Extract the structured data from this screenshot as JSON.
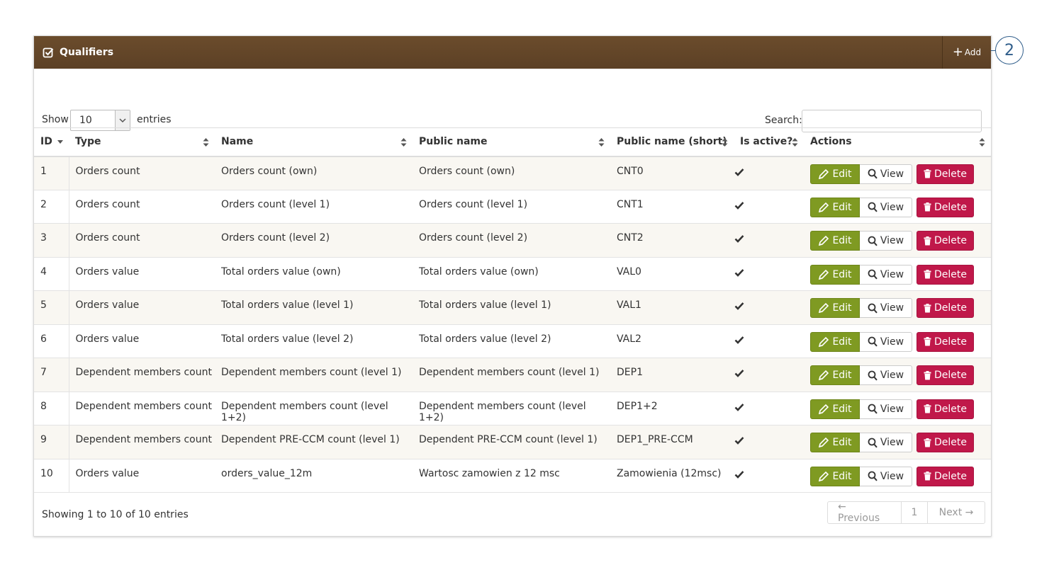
{
  "panel": {
    "title": "Qualifiers",
    "add_label": "Add",
    "callout_number": "2"
  },
  "controls": {
    "show_label": "Show",
    "entries_value": "10",
    "entries_label": "entries",
    "search_label": "Search:",
    "search_value": ""
  },
  "table": {
    "columns": [
      "ID",
      "Type",
      "Name",
      "Public name",
      "Public name (short)",
      "Is active?",
      "Actions"
    ],
    "actions": {
      "edit": "Edit",
      "view": "View",
      "delete": "Delete"
    },
    "rows": [
      {
        "id": "1",
        "type": "Orders count",
        "name": "Orders count (own)",
        "public_name": "Orders count (own)",
        "short": "CNT0",
        "active": true
      },
      {
        "id": "2",
        "type": "Orders count",
        "name": "Orders count (level 1)",
        "public_name": "Orders count (level 1)",
        "short": "CNT1",
        "active": true
      },
      {
        "id": "3",
        "type": "Orders count",
        "name": "Orders count (level 2)",
        "public_name": "Orders count (level 2)",
        "short": "CNT2",
        "active": true
      },
      {
        "id": "4",
        "type": "Orders value",
        "name": "Total orders value (own)",
        "public_name": "Total orders value (own)",
        "short": "VAL0",
        "active": true
      },
      {
        "id": "5",
        "type": "Orders value",
        "name": "Total orders value (level 1)",
        "public_name": "Total orders value (level 1)",
        "short": "VAL1",
        "active": true
      },
      {
        "id": "6",
        "type": "Orders value",
        "name": "Total orders value (level 2)",
        "public_name": "Total orders value (level 2)",
        "short": "VAL2",
        "active": true
      },
      {
        "id": "7",
        "type": "Dependent members count",
        "name": "Dependent members count (level 1)",
        "public_name": "Dependent members count (level 1)",
        "short": "DEP1",
        "active": true
      },
      {
        "id": "8",
        "type": "Dependent members count",
        "name": "Dependent members count (level 1+2)",
        "public_name": "Dependent members count (level 1+2)",
        "short": "DEP1+2",
        "active": true
      },
      {
        "id": "9",
        "type": "Dependent members count",
        "name": "Dependent PRE-CCM count (level 1)",
        "public_name": "Dependent PRE-CCM count (level 1)",
        "short": "DEP1_PRE-CCM",
        "active": true
      },
      {
        "id": "10",
        "type": "Orders value",
        "name": "orders_value_12m",
        "public_name": "Wartosc zamowien z 12 msc",
        "short": "Zamowienia (12msc)",
        "active": true
      }
    ]
  },
  "footer": {
    "info": "Showing 1 to 10 of 10 entries",
    "prev": "← Previous",
    "page": "1",
    "next": "Next →"
  },
  "colors": {
    "header_bg": "#5c4025",
    "edit_bg": "#7f9a22",
    "delete_bg": "#c0184a",
    "callout": "#2f5d8a"
  }
}
